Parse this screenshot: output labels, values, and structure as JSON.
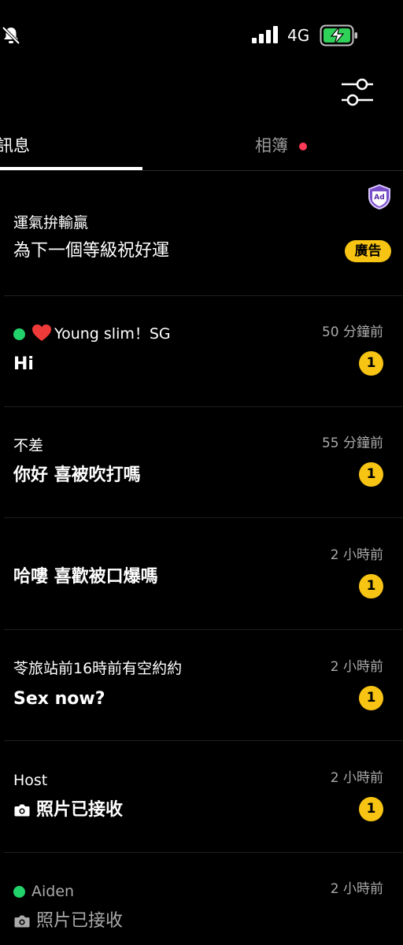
{
  "status_bar": {
    "network": "4G",
    "battery_charging": true,
    "signal_bars": 4
  },
  "header": {
    "filter_icon": "sliders-icon"
  },
  "tabs": [
    {
      "label": "訊息",
      "active": true
    },
    {
      "label": "相簿",
      "has_notification_dot": true
    }
  ],
  "ad": {
    "title": "運氣拚輸贏",
    "message": "為下一個等級祝好運",
    "label": "廣告",
    "icon": "ad-shield-icon"
  },
  "conversations": [
    {
      "name": "Young slim！SG",
      "message": "Hi",
      "time": "50 分鐘前",
      "unread": "1",
      "online": true,
      "heart": true
    },
    {
      "name": "不差",
      "message": "你好 喜被吹打嗎",
      "time": "55 分鐘前",
      "unread": "1"
    },
    {
      "name": "",
      "message": "哈嘍 喜歡被口爆嗎",
      "time": "2 小時前",
      "unread": "1"
    },
    {
      "name": "苓旅站前16時前有空約約",
      "message": "Sex now?",
      "time": "2 小時前",
      "unread": "1"
    },
    {
      "name": "Host",
      "message": "照片已接收",
      "time": "2 小時前",
      "unread": "1",
      "photo": true
    },
    {
      "name": "Aiden",
      "message": "照片已接收",
      "time": "2 小時前",
      "online": true,
      "photo": true
    }
  ],
  "colors": {
    "background": "#000000",
    "badge": "#f7c414",
    "online": "#22d36b",
    "notification_dot": "#ff3b57"
  }
}
